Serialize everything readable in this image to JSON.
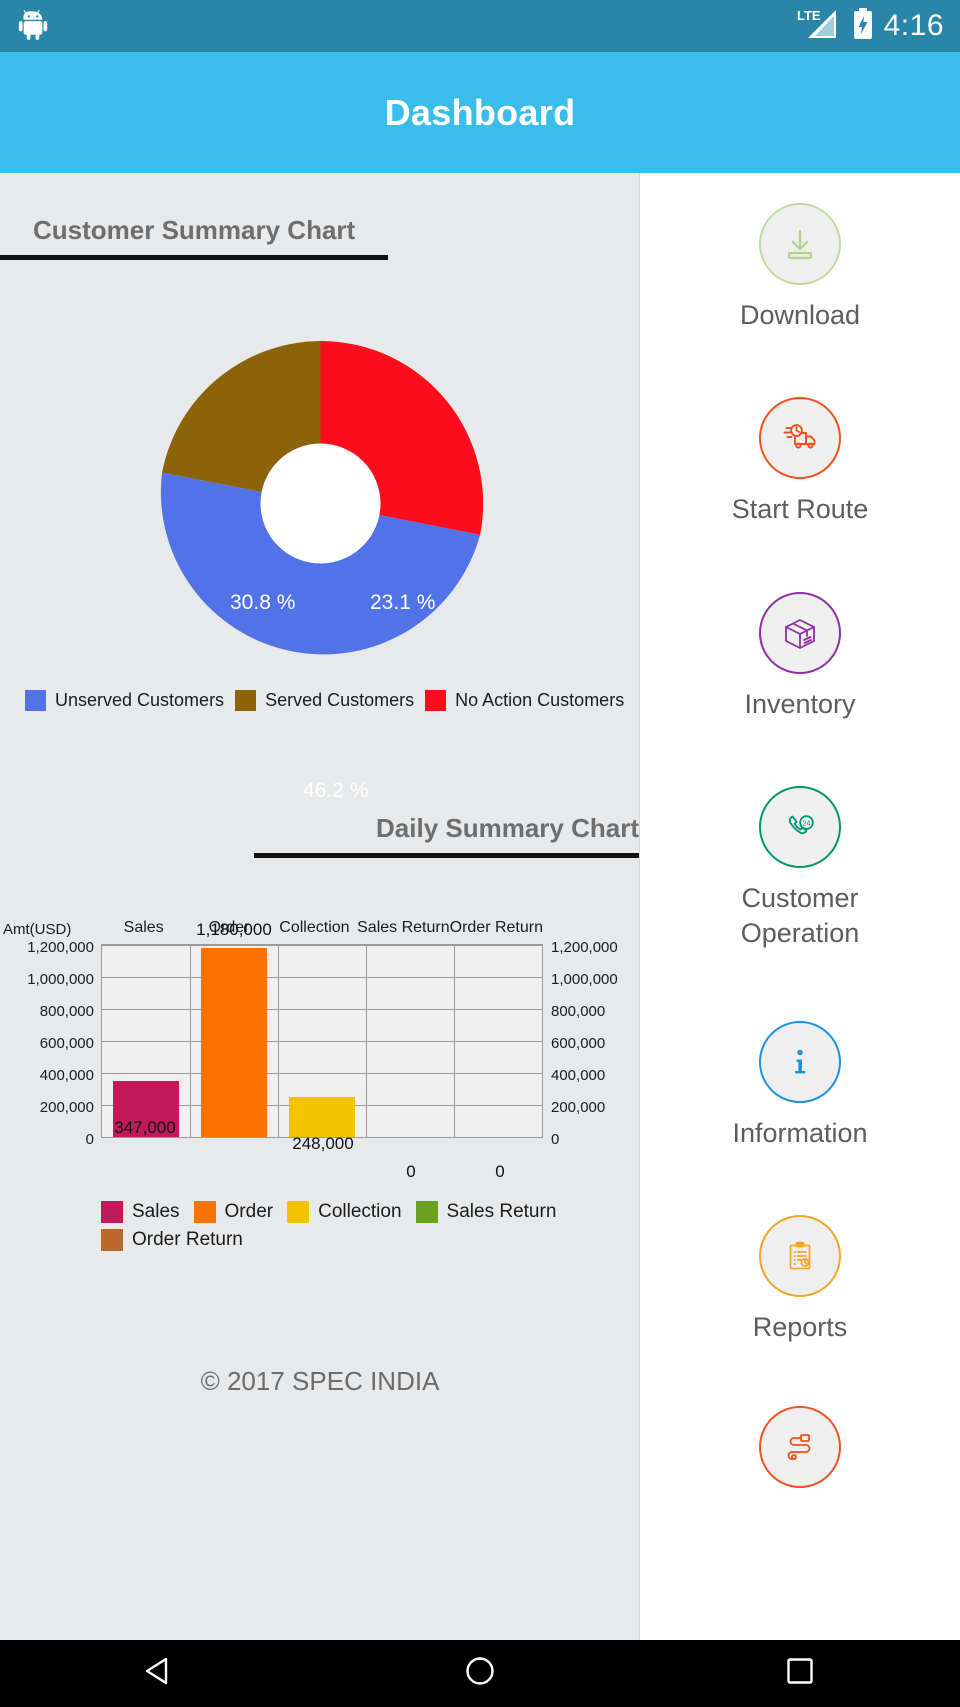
{
  "statusbar": {
    "network_label": "LTE",
    "time": "4:16",
    "icons": [
      "android-robot-icon",
      "lte-signal-icon",
      "battery-charging-icon"
    ]
  },
  "appbar": {
    "title": "Dashboard"
  },
  "customer_summary": {
    "title": "Customer Summary Chart"
  },
  "daily_summary": {
    "title": "Daily Summary Chart"
  },
  "footer": {
    "copyright": "© 2017 SPEC INDIA"
  },
  "sidebar": {
    "items": [
      {
        "label": "Download",
        "icon": "download-icon",
        "color": "#b5d08a"
      },
      {
        "label": "Start Route",
        "icon": "delivery-truck-clock-icon",
        "color": "#f4501e"
      },
      {
        "label": "Inventory",
        "icon": "package-box-icon",
        "color": "#8e2fa3"
      },
      {
        "label": "Customer\nOperation",
        "icon": "phone-24h-support-icon",
        "color": "#00976b"
      },
      {
        "label": "Information",
        "icon": "info-icon",
        "color": "#1c92e0"
      },
      {
        "label": "Reports",
        "icon": "clipboard-report-icon",
        "color": "#f5a623"
      },
      {
        "label": "",
        "icon": "route-map-icon",
        "color": "#f4501e"
      }
    ]
  },
  "navbar": {
    "buttons": [
      {
        "name": "back-button",
        "icon": "triangle-back-icon"
      },
      {
        "name": "home-button",
        "icon": "circle-home-icon"
      },
      {
        "name": "recents-button",
        "icon": "square-recents-icon"
      }
    ]
  },
  "chart_data": [
    {
      "type": "pie",
      "variant": "donut",
      "title": "Customer Summary Chart",
      "categories": [
        "No Action Customers",
        "Unserved Customers",
        "Served Customers"
      ],
      "values": [
        23.1,
        46.2,
        30.8
      ],
      "value_labels": [
        "23.1 %",
        "46.2 %",
        "30.8 %"
      ],
      "colors": [
        "#fb0d1b",
        "#5273e8",
        "#8c6308"
      ],
      "legend": [
        {
          "label": "Unserved Customers",
          "color": "#5273e8",
          "value": 46.2,
          "value_label": "46.2 %"
        },
        {
          "label": "Served Customers",
          "color": "#8c6308",
          "value": 30.8,
          "value_label": "30.8 %"
        },
        {
          "label": "No Action Customers",
          "color": "#fb0d1b",
          "value": 23.1,
          "value_label": "23.1 %"
        }
      ],
      "legend_position": "bottom",
      "units": "percent"
    },
    {
      "type": "bar",
      "title": "Daily Summary Chart",
      "ylabel": "Amt(USD)",
      "categories": [
        "Sales",
        "Order",
        "Collection",
        "Sales Return",
        "Order Return"
      ],
      "values": [
        347000,
        1180000,
        248000,
        0,
        0
      ],
      "value_labels": [
        "347,000",
        "1,180,000",
        "248,000",
        "0",
        "0"
      ],
      "colors": [
        "#c2195b",
        "#fb7200",
        "#f5c400",
        "#6aa121",
        "#b9692e"
      ],
      "ylim": [
        0,
        1200000
      ],
      "yticks": [
        0,
        200000,
        400000,
        600000,
        800000,
        1000000,
        1200000
      ],
      "ytick_labels": [
        "0",
        "200,000",
        "400,000",
        "600,000",
        "800,000",
        "1,000,000",
        "1,200,000"
      ],
      "dual_axis": true,
      "grid": true,
      "legend": [
        {
          "label": "Sales",
          "color": "#c2195b"
        },
        {
          "label": "Order",
          "color": "#fb7200"
        },
        {
          "label": "Collection",
          "color": "#f5c400"
        },
        {
          "label": "Sales Return",
          "color": "#6aa121"
        },
        {
          "label": "Order Return",
          "color": "#b9692e"
        }
      ],
      "legend_position": "bottom"
    }
  ]
}
